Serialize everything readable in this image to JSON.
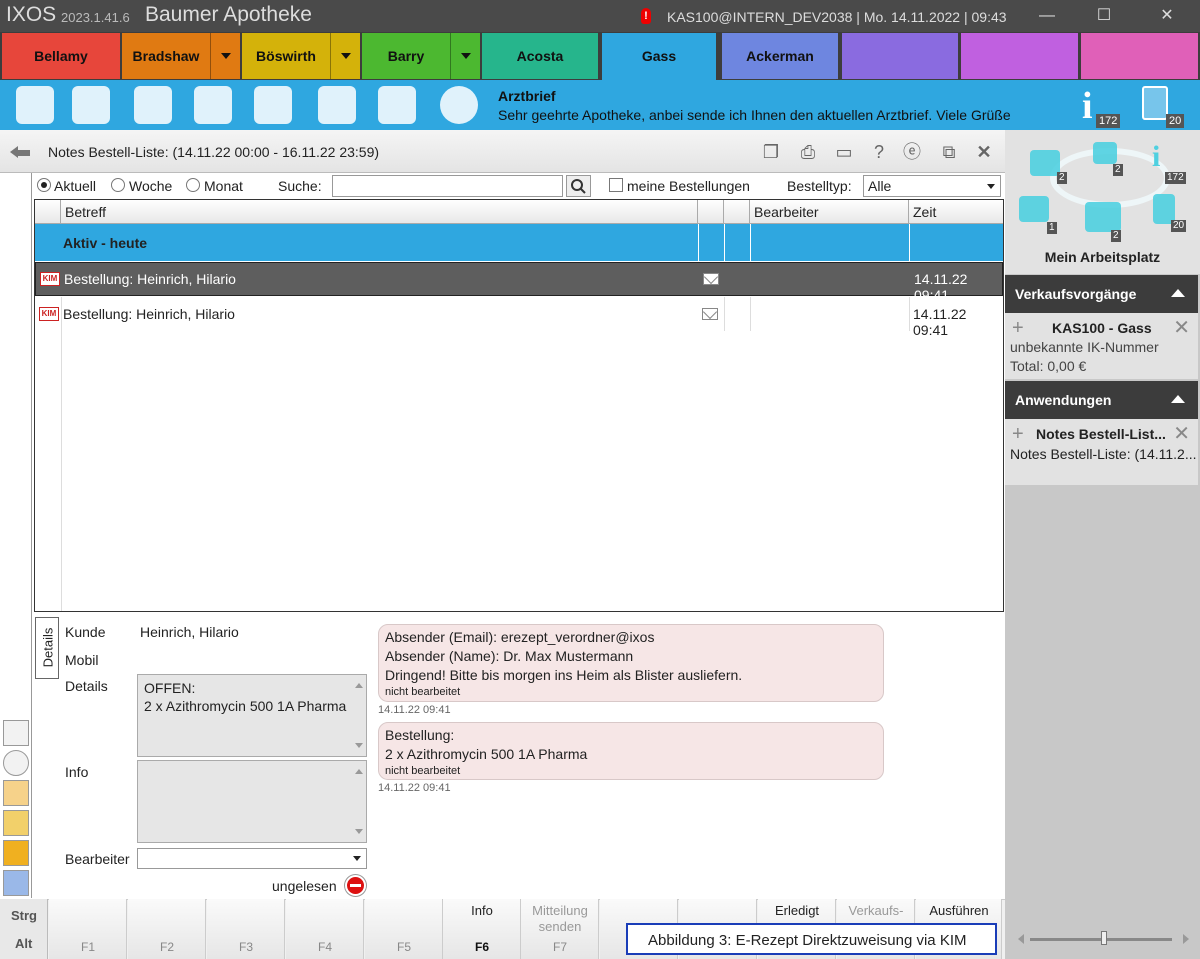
{
  "titlebar": {
    "app": "IXOS",
    "version": "2023.1.41.6",
    "pharmacy": "Baumer Apotheke",
    "alert": "!",
    "session": "KAS100@INTERN_DEV2038  |  Mo. 14.11.2022  |  09:43",
    "minimize": "—",
    "maximize": "☐",
    "close": "✕"
  },
  "tabs": [
    {
      "label": "Bellamy",
      "color": "#e7463b"
    },
    {
      "label": "Bradshaw",
      "color": "#e07a12"
    },
    {
      "label": "Böswirth",
      "color": "#d4b20a"
    },
    {
      "label": "Barry",
      "color": "#4cb830"
    },
    {
      "label": "Acosta",
      "color": "#26b58c"
    },
    {
      "label": "Gass",
      "color": "#2fa7e0"
    },
    {
      "label": "Ackerman",
      "color": "#6e86e0"
    }
  ],
  "toolbar": {
    "letter_title": "Arztbrief",
    "letter_text": "Sehr geehrte Apotheke, anbei sende ich Ihnen den aktuellen Arztbrief. Viele Grüße",
    "info_count": "172",
    "clip_count": "20"
  },
  "panel": {
    "title": "Notes Bestell-Liste: (14.11.22 00:00 - 16.11.22 23:59)"
  },
  "filter": {
    "aktuell": "Aktuell",
    "woche": "Woche",
    "monat": "Monat",
    "search_label": "Suche:",
    "search_value": "",
    "meine": "meine Bestellungen",
    "type_label": "Bestelltyp:",
    "type_value": "Alle"
  },
  "grid": {
    "headers": {
      "betreff": "Betreff",
      "bearbeiter": "Bearbeiter",
      "zeit": "Zeit"
    },
    "group": "Aktiv - heute",
    "kim": "KIM",
    "rows": [
      {
        "betreff": "Bestellung: Heinrich, Hilario",
        "zeit": "14.11.22 09:41"
      },
      {
        "betreff": "Bestellung: Heinrich, Hilario",
        "zeit": "14.11.22 09:41"
      }
    ]
  },
  "details": {
    "tab": "Details",
    "kunde_label": "Kunde",
    "kunde_value": "Heinrich, Hilario",
    "mobil_label": "Mobil",
    "details_label": "Details",
    "details_line1": "OFFEN:",
    "details_line2": "2 x Azithromycin 500 1A Pharma",
    "info_label": "Info",
    "bearbeiter_label": "Bearbeiter",
    "ungelesen": "ungelesen"
  },
  "messages": [
    {
      "line1": "Absender (Email): erezept_verordner@ixos",
      "line2": "Absender (Name): Dr. Max Mustermann",
      "line3": "Dringend! Bitte bis morgen ins Heim als Blister ausliefern.",
      "status": "nicht bearbeitet",
      "time": "14.11.22 09:41"
    },
    {
      "line1": "Bestellung:",
      "line2": "2 x Azithromycin 500 1A Pharma",
      "status": "nicht bearbeitet",
      "time": "14.11.22 09:41"
    }
  ],
  "side": {
    "badges": {
      "b1": "2",
      "b2": "2",
      "b3": "172",
      "b4": "1",
      "b5": "2",
      "b6": "20"
    },
    "workplace": "Mein Arbeitsplatz",
    "verkauf_head": "Verkaufsvorgänge",
    "verkauf_title": "KAS100 - Gass",
    "verkauf_line1": "unbekannte IK-Nummer",
    "verkauf_line2": "Total: 0,00 €",
    "anw_head": "Anwendungen",
    "anw_title": "Notes Bestell-List...",
    "anw_line1": "Notes Bestell-Liste: (14.11.2..."
  },
  "fkeys": {
    "strg": "Strg",
    "alt": "Alt",
    "keys": [
      {
        "top": "",
        "key": "F1"
      },
      {
        "top": "",
        "key": "F2"
      },
      {
        "top": "",
        "key": "F3"
      },
      {
        "top": "",
        "key": "F4"
      },
      {
        "top": "",
        "key": "F5"
      },
      {
        "top": "Info",
        "key": "F6"
      },
      {
        "top": "Mitteilung senden",
        "key": "F7"
      },
      {
        "top": "",
        "key": ""
      },
      {
        "top": "",
        "key": ""
      },
      {
        "top": "Erledigt",
        "key": ""
      },
      {
        "top": "Verkaufs-",
        "key": ""
      },
      {
        "top": "Ausführen",
        "key": ""
      }
    ]
  },
  "caption": "Abbildung 3: E-Rezept Direktzuweisung via KIM"
}
